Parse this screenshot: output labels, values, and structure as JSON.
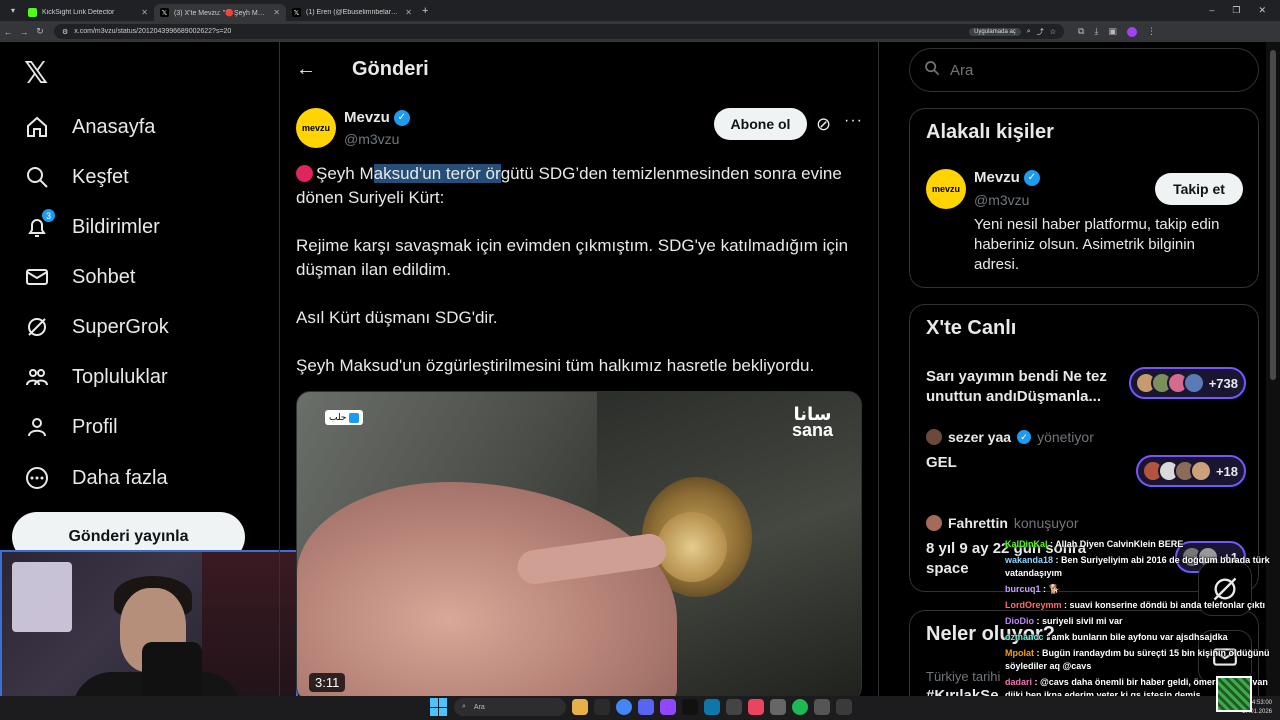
{
  "browser": {
    "tabs": [
      {
        "title": "KickSight Link Detector"
      },
      {
        "title": "(3) X'te Mevzu: \"🔴Şeyh Maksu..."
      },
      {
        "title": "(1) Eren (@Ebuselimnbelarus) /"
      }
    ],
    "url": "x.com/m3vzu/status/2012043996689002622?s=20",
    "app_chip": "Uygulamada aç"
  },
  "nav": {
    "items": [
      {
        "label": "Anasayfa",
        "icon": "home-icon"
      },
      {
        "label": "Keşfet",
        "icon": "search-icon"
      },
      {
        "label": "Bildirimler",
        "icon": "bell-icon",
        "badge": "3"
      },
      {
        "label": "Sohbet",
        "icon": "mail-icon"
      },
      {
        "label": "SuperGrok",
        "icon": "grok-icon"
      },
      {
        "label": "Topluluklar",
        "icon": "communities-icon"
      },
      {
        "label": "Profil",
        "icon": "profile-icon"
      },
      {
        "label": "Daha fazla",
        "icon": "more-icon"
      }
    ],
    "post_button": "Gönderi yayınla"
  },
  "post": {
    "header_title": "Gönderi",
    "author": {
      "name": "Mevzu",
      "handle": "@m3vzu",
      "avatar_text": "mevzu"
    },
    "subscribe_label": "Abone ol",
    "text_line1_pre": "Şeyh M",
    "text_line1_hl": "aksud'un terör ör",
    "text_line1_post": "gütü SDG’den temizlenmesinden sonra evine dönen Suriyeli Kürt:",
    "paragraph2": "Rejime karşı savaşmak için evimden çıkmıştım. SDG'ye katılmadığım için düşman ilan edildim.",
    "paragraph3": "Asıl Kürt düşmanı SDG'dir.",
    "paragraph4": "Şeyh Maksud'un özgürleştirilmesini tüm halkımız hasretle bekliyordu.",
    "media": {
      "location": "حلب",
      "brand_ar": "سانا",
      "brand": "sana",
      "duration": "3:11"
    }
  },
  "right": {
    "search_placeholder": "Ara",
    "related": {
      "title": "Alakalı kişiler",
      "name": "Mevzu",
      "handle": "@m3vzu",
      "avatar_text": "mevzu",
      "follow_label": "Takip et",
      "bio": "Yeni nesil haber platformu, takip edin haberiniz olsun. Asimetrik bilginin adresi."
    },
    "live": {
      "title": "X'te Canlı",
      "items": [
        {
          "title": "Sarı yayımın bendi Ne tez unuttun andıDüşmanla...",
          "count": "+738"
        },
        {
          "host": "sezer yaa",
          "role": "yönetiyor",
          "title": "GEL",
          "count": "+18"
        },
        {
          "host": "Fahrettin",
          "role": "konuşuyor",
          "title": "8 yıl 9 ay 22 gün sonra space",
          "count": "+1"
        }
      ]
    },
    "trends_title": "Neler oluyor?",
    "trend_sub": "Türkiye tarihi",
    "trend_tag": "#KırılakSe"
  },
  "chat": [
    {
      "user": "KalDinKal",
      "text": "Allah Diyen CalvinKlein BERE",
      "color": "#53fc18"
    },
    {
      "user": "wakanda18",
      "text": "Ben Suriyeliyim abi 2016 de doğdum burada türk vatandaşıyım",
      "color": "#8fd3ff"
    },
    {
      "user": "burcuq1",
      "text": "🐕",
      "color": "#c6a4ff"
    },
    {
      "user": "LordOreymm",
      "text": "suavi konserine döndü bi anda telefonlar çıktı",
      "color": "#ff6b6b"
    },
    {
      "user": "DioDio",
      "text": "suriyeli sivil mi var",
      "color": "#c084fc"
    },
    {
      "user": "ozmancc",
      "text": "amk bunların bile ayfonu var ajsdhsajdka",
      "color": "#5eead4"
    },
    {
      "user": "Mpolat",
      "text": "Bugün irandaydım bu süreçti 15 bin kişinin öldüğünü söylediler aq @cavs",
      "color": "#f59e0b"
    },
    {
      "user": "dadari",
      "text": "@cavs daha önemli bir haber geldi, ömer bayram van dijki ben ikna ederim yeter ki gs istesin demiş",
      "color": "#f472b6"
    }
  ],
  "taskbar": {
    "search": "Ara",
    "time": "14:53:00",
    "date": "17.01.2026"
  },
  "colors": {
    "accent": "#1d9bf0",
    "live_border": "#7856ff",
    "brand_yellow": "#ffd400"
  }
}
